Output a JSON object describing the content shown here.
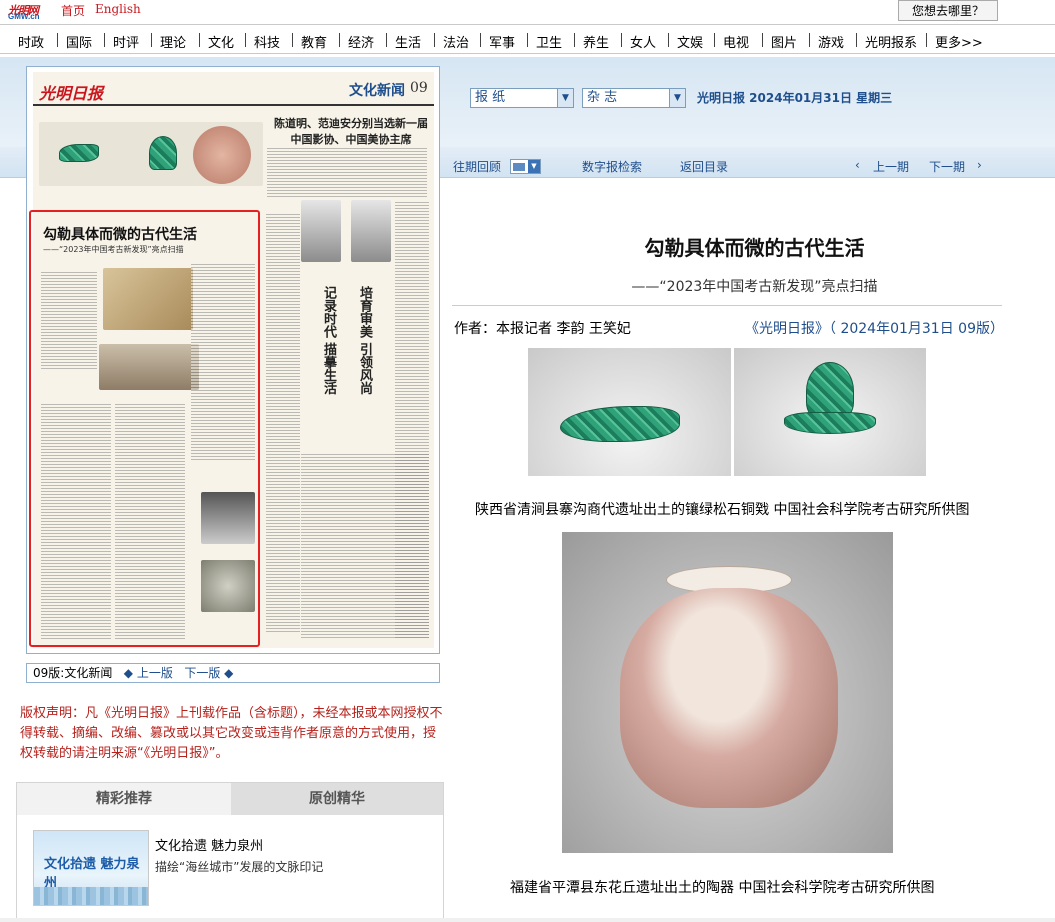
{
  "topbar": {
    "logo_line1": "光明网",
    "logo_line2": "GMW.cn",
    "home": "首页",
    "english": "English",
    "where": "您想去哪里？"
  },
  "nav": [
    "时政",
    "国际",
    "时评",
    "理论",
    "文化",
    "科技",
    "教育",
    "经济",
    "生活",
    "法治",
    "军事",
    "卫生",
    "养生",
    "女人",
    "文娱",
    "电视",
    "图片",
    "游戏",
    "光明报系",
    "更多>>"
  ],
  "header": {
    "select_paper": "报  纸",
    "select_magazine": "杂  志",
    "date": "光明日报  2024年01月31日  星期三",
    "past_review": "往期回顾",
    "digital_search": "数字报检索",
    "back_to_index": "返回目录",
    "prev_issue": "上一期",
    "next_issue": "下一期"
  },
  "paper": {
    "masthead": "光明日报",
    "section": "文化新闻",
    "page_no": "09",
    "headline_top": "陈道明、范迪安分别当选新一届中国影协、中国美协主席",
    "box_title": "勾勒具体而微的古代生活",
    "box_subtitle": "——“2023年中国考古新发现”亮点扫描",
    "vtitle1": "记录时代 描摹生活",
    "vtitle2": "培育审美 引领风尚"
  },
  "pagebar": {
    "current": "09版:文化新闻",
    "prev": "上一版",
    "next": "下一版"
  },
  "copyright": "版权声明：凡《光明日报》上刊载作品（含标题），未经本报或本网授权不得转载、摘编、改编、篡改或以其它改变或违背作者原意的方式使用，授权转载的请注明来源“《光明日报》”。",
  "recommend": {
    "tab_featured": "精彩推荐",
    "tab_original": "原创精华",
    "thumb_text": "文化拾遗 魅力泉州",
    "item_title": "文化拾遗 魅力泉州",
    "item_desc": "描绘“海丝城市”发展的文脉印记"
  },
  "article": {
    "title": "勾勒具体而微的古代生活",
    "subtitle": "——“2023年中国考古新发现”亮点扫描",
    "author": "作者：本报记者 李韵 王笑妃",
    "source": "《光明日报》（ 2024年01月31日   09版）",
    "caption1": "陕西省清涧县寨沟商代遗址出土的镶绿松石铜戣   中国社会科学院考古研究所供图",
    "caption2": "福建省平潭县东花丘遗址出土的陶器   中国社会科学院考古研究所供图"
  },
  "colors": {
    "brand_red": "#c8171e",
    "link_blue": "#1f4e8c",
    "copyright_red": "#b5221c",
    "highlight_box": "#e62020"
  }
}
